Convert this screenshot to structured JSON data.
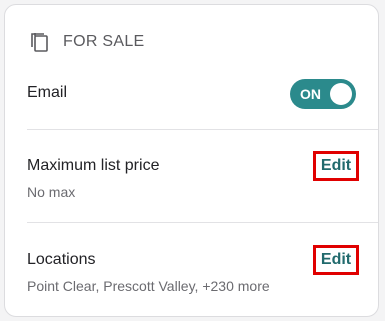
{
  "section": {
    "title": "FOR SALE",
    "icon": "copy-icon"
  },
  "email": {
    "label": "Email",
    "toggle_state": "ON"
  },
  "max_price": {
    "label": "Maximum list price",
    "value": "No max",
    "edit_label": "Edit"
  },
  "locations": {
    "label": "Locations",
    "value": "Point Clear, Prescott Valley, +230 more",
    "edit_label": "Edit"
  },
  "colors": {
    "toggle_on": "#2b8a8c",
    "edit_text": "#216a6d",
    "highlight_border": "#e00000"
  }
}
